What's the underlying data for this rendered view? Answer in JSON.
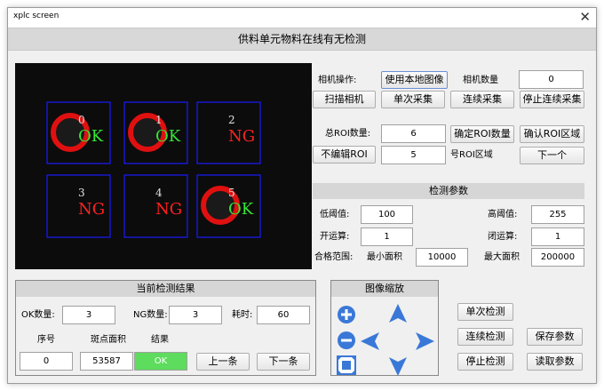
{
  "window": {
    "title": "xplc screen",
    "close_symbol": "✕",
    "header": "供料单元物料在线有无检测"
  },
  "camera_view": {
    "rois": [
      {
        "index": "0",
        "result": "OK",
        "has_ring": true
      },
      {
        "index": "1",
        "result": "OK",
        "has_ring": true
      },
      {
        "index": "2",
        "result": "NG",
        "has_ring": false
      },
      {
        "index": "3",
        "result": "NG",
        "has_ring": false
      },
      {
        "index": "4",
        "result": "NG",
        "has_ring": false
      },
      {
        "index": "5",
        "result": "OK",
        "has_ring": true
      }
    ],
    "colors": {
      "ok": "#35e635",
      "ng": "#ff2020",
      "roi_box": "#1a1aff",
      "ring": "#e01010",
      "index": "#e0e0e0"
    }
  },
  "camera_ops": {
    "label": "相机操作:",
    "use_local_image": "使用本地图像",
    "camera_count_label": "相机数量",
    "camera_count": "0",
    "scan_camera": "扫描相机",
    "single_capture": "单次采集",
    "continuous_capture": "连续采集",
    "stop_continuous": "停止连续采集"
  },
  "roi": {
    "total_label": "总ROI数量:",
    "total_value": "6",
    "confirm_count": "确定ROI数量",
    "confirm_region": "确认ROI区域",
    "no_edit": "不编辑ROI",
    "region_number": "5",
    "region_suffix": "号ROI区域",
    "next": "下一个"
  },
  "detection_params": {
    "title": "检测参数",
    "low_threshold_label": "低阈值:",
    "low_threshold": "100",
    "high_threshold_label": "高阈值:",
    "high_threshold": "255",
    "opening_label": "开运算:",
    "opening": "1",
    "closing_label": "闭运算:",
    "closing": "1",
    "range_label": "合格范围:",
    "min_area_label": "最小面积",
    "min_area": "10000",
    "max_area_label": "最大面积",
    "max_area": "200000"
  },
  "current_result": {
    "title": "当前检测结果",
    "ok_count_label": "OK数量:",
    "ok_count": "3",
    "ng_count_label": "NG数量:",
    "ng_count": "3",
    "time_label": "耗时:",
    "time_value": "60",
    "col_index": "序号",
    "col_area": "斑点面积",
    "col_result": "结果",
    "index_value": "0",
    "area_value": "53587",
    "result_value": "OK",
    "prev": "上一条",
    "next": "下一条"
  },
  "zoom": {
    "title": "图像缩放",
    "icons": [
      "zoom-in-icon",
      "arrow-up-icon",
      "zoom-out-icon",
      "arrow-left-icon",
      "arrow-right-icon",
      "fit-screen-icon",
      "arrow-down-icon"
    ],
    "icon_color": "#3a78d8"
  },
  "actions": {
    "single_detect": "单次检测",
    "continuous_detect": "连续检测",
    "save_params": "保存参数",
    "stop_detect": "停止检测",
    "read_params": "读取参数"
  }
}
